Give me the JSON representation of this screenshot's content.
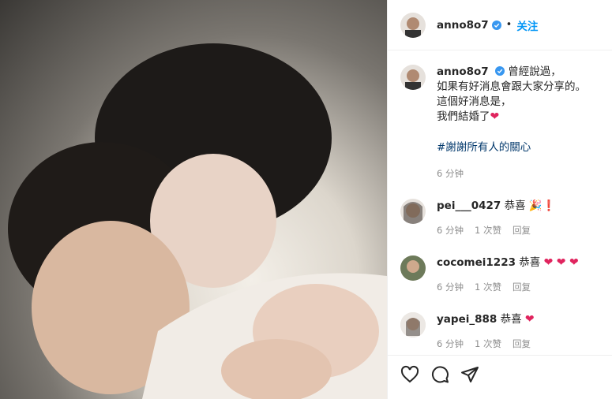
{
  "post": {
    "username": "anno8o7",
    "dot": "•",
    "follow_label": "关注"
  },
  "caption": {
    "username": "anno8o7",
    "lines": [
      "曾經說過，",
      "如果有好消息會跟大家分享的。",
      "這個好消息是，",
      "我們結婚了"
    ],
    "hashtag": "#謝謝所有人的關心",
    "time": "6 分钟"
  },
  "comments": [
    {
      "username": "pei___0427",
      "text": "恭喜",
      "emojis": "🎉❗",
      "time": "6 分钟",
      "likes": "1 次赞",
      "reply": "回复"
    },
    {
      "username": "cocomei1223",
      "text": "恭喜",
      "emojis": "❤ ❤ ❤",
      "time": "6 分钟",
      "likes": "1 次赞",
      "reply": "回复"
    },
    {
      "username": "yapei_888",
      "text": "恭喜",
      "emojis": "❤",
      "time": "6 分钟",
      "likes": "1 次赞",
      "reply": "回复"
    }
  ],
  "icons": {
    "like": "heart-icon",
    "comment": "comment-icon",
    "share": "share-icon"
  },
  "colors": {
    "link": "#0095f6",
    "hashtag": "#00376b",
    "heart": "#e0245e",
    "meta": "#8e8e8e"
  }
}
